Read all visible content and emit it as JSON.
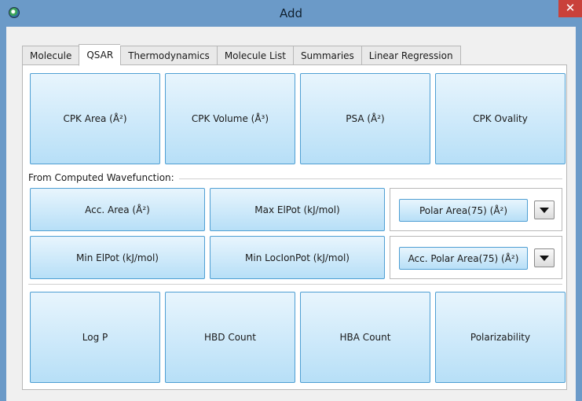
{
  "window": {
    "title": "Add",
    "close_glyph": "✕",
    "icon": "app-icon"
  },
  "tabs": [
    "Molecule",
    "QSAR",
    "Thermodynamics",
    "Molecule List",
    "Summaries",
    "Linear Regression"
  ],
  "active_tab": "QSAR",
  "top_buttons": [
    "CPK Area (Å²)",
    "CPK Volume (Å³)",
    "PSA (Å²)",
    "CPK Ovality"
  ],
  "section_label": "From Computed Wavefunction:",
  "wave_buttons": {
    "acc_area": "Acc. Area (Å²)",
    "max_elpot": "Max ElPot (kJ/mol)",
    "min_elpot": "Min ElPot (kJ/mol)",
    "min_locionpot": "Min LocIonPot (kJ/mol)"
  },
  "combos": {
    "polar_area": "Polar Area(75) (Å²)",
    "acc_polar_area": "Acc. Polar Area(75) (Å²)"
  },
  "bottom_buttons": [
    "Log P",
    "HBD Count",
    "HBA Count",
    "Polarizability"
  ],
  "colors": {
    "title_bar": "#6b9ac8",
    "button_border": "#4f9fd3",
    "close_button": "#c9413a"
  }
}
